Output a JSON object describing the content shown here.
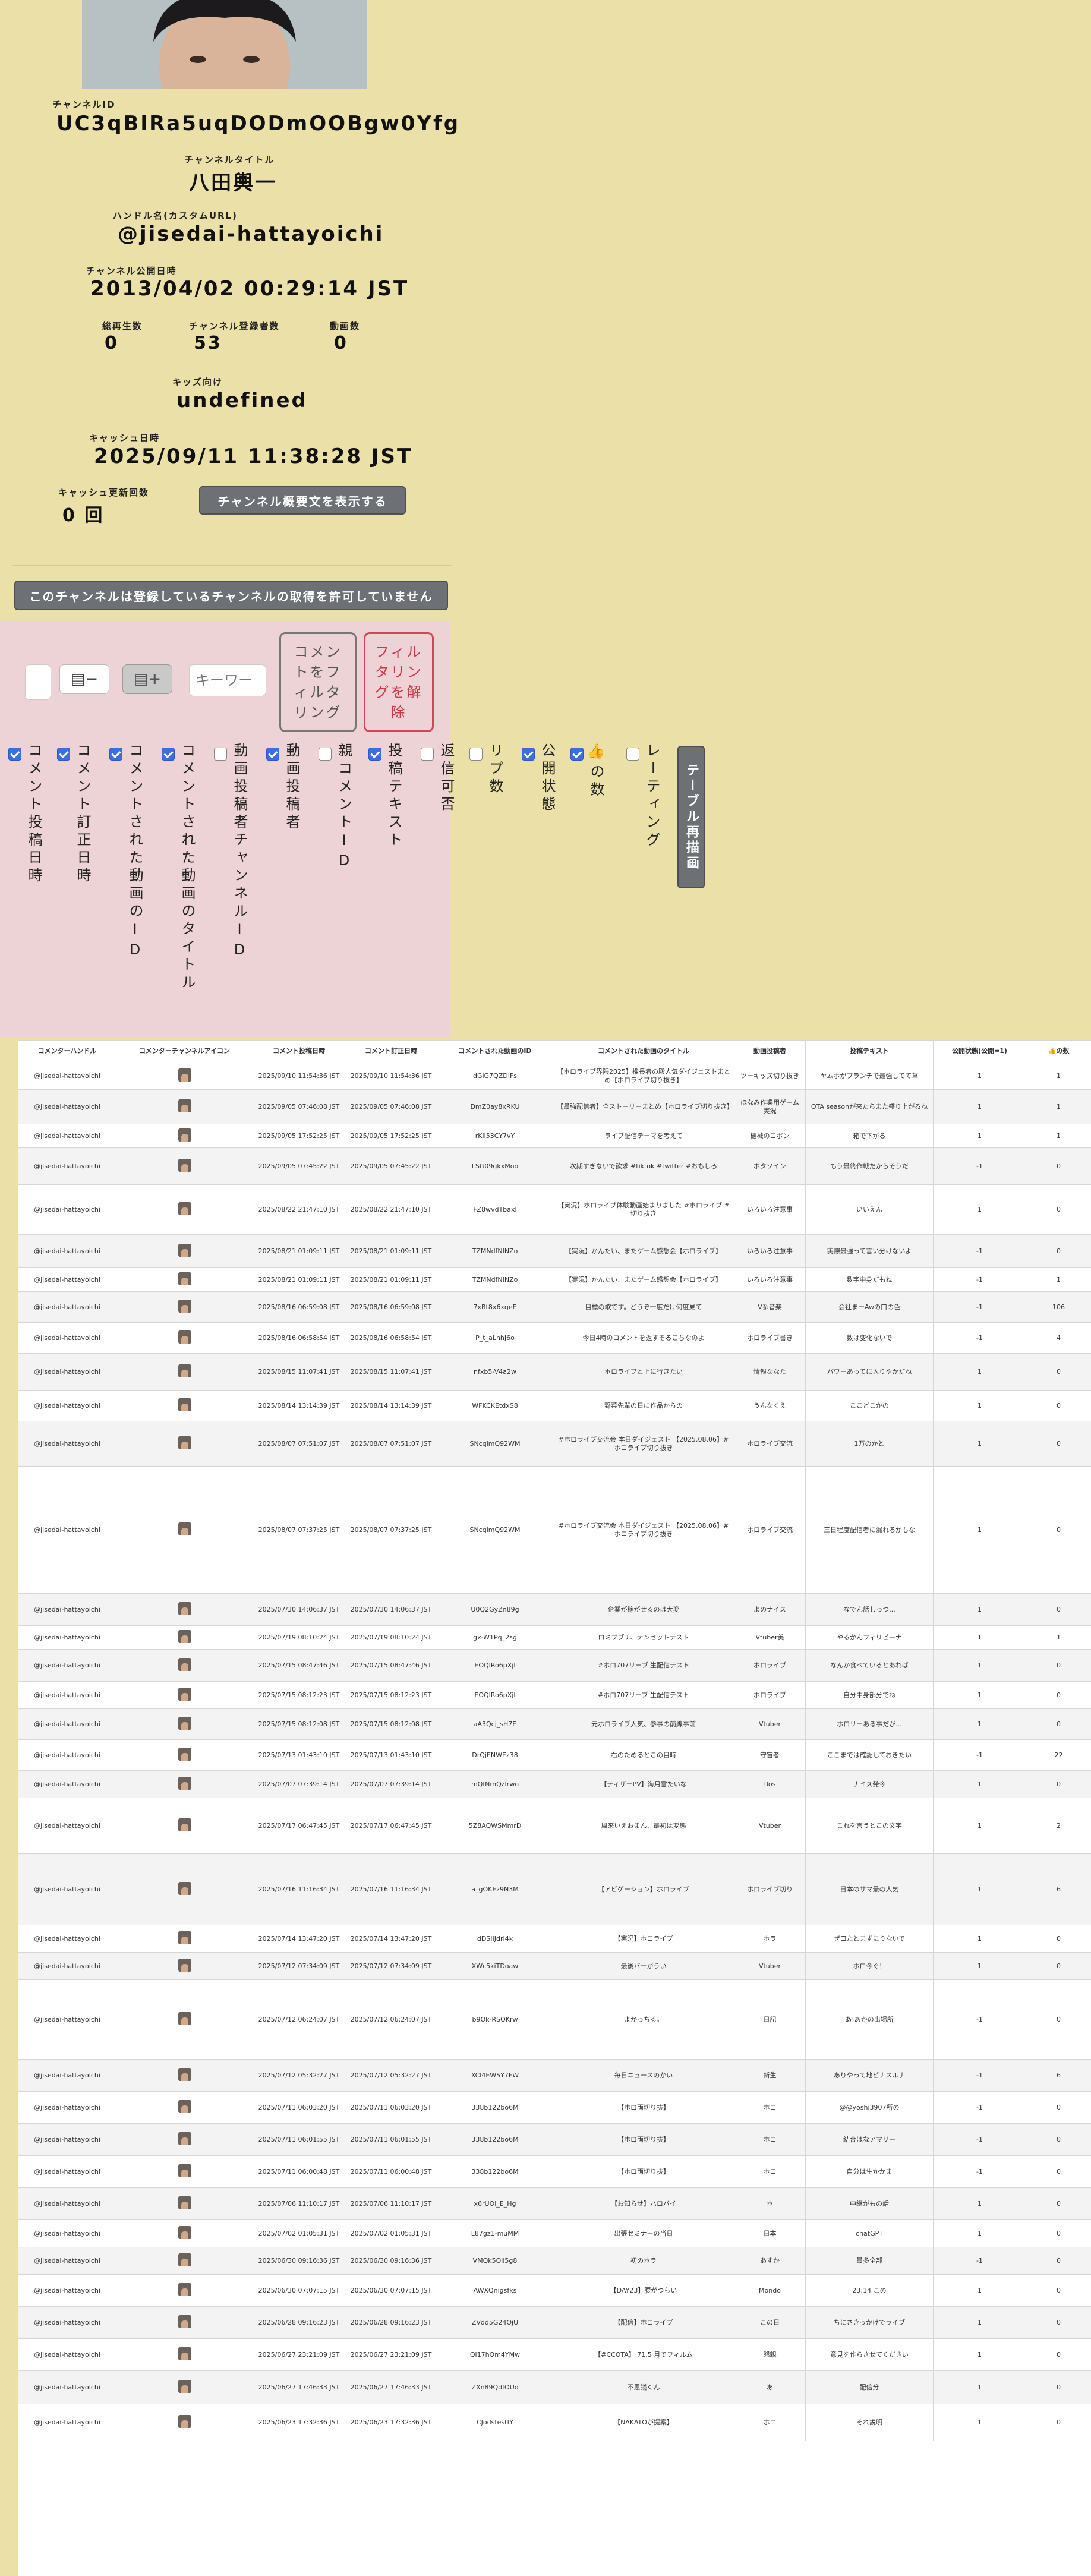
{
  "channel": {
    "id_label": "チャンネルID",
    "id": "UC3qBlRa5uqDODmOOBgw0Yfg",
    "title_label": "チャンネルタイトル",
    "title": "八田輿一",
    "handle_label": "ハンドル名(カスタムURL)",
    "handle": "@jisedai-hattayoichi",
    "published_label": "チャンネル公開日時",
    "published": "2013/04/02 00:29:14 JST",
    "views_label": "総再生数",
    "views": "0",
    "subs_label": "チャンネル登録者数",
    "subs": "53",
    "videos_label": "動画数",
    "videos": "0",
    "kids_label": "キッズ向け",
    "kids": "undefined",
    "cache_label": "キャッシュ日時",
    "cache": "2025/09/11 11:38:28 JST",
    "cache_count_label": "キャッシュ更新回数",
    "cache_count": "0 回",
    "show_desc_button": "チャンネル概要文を表示する",
    "no_subs_button": "このチャンネルは登録しているチャンネルの取得を許可していません"
  },
  "filter": {
    "minus_icon": "▤−",
    "plus_icon": "▤+",
    "keyword_placeholder": "キーワー",
    "filter_button": "コメントをフィルタリング",
    "clear_button": "フィルタリングを解除",
    "redraw_button": "テーブル再描画",
    "columns": [
      {
        "label": "コメント投稿日時",
        "checked": true
      },
      {
        "label": "コメント訂正日時",
        "checked": true
      },
      {
        "label": "コメントされた動画のID",
        "checked": true
      },
      {
        "label": "コメントされた動画のタイトル",
        "checked": true
      },
      {
        "label": "動画投稿者チャンネルID",
        "checked": false
      },
      {
        "label": "動画投稿者",
        "checked": true
      },
      {
        "label": "親コメントID",
        "checked": false
      },
      {
        "label": "投稿テキスト",
        "checked": true
      },
      {
        "label": "返信可否",
        "checked": false
      },
      {
        "label": "リプ数",
        "checked": false
      },
      {
        "label": "公開状態",
        "checked": true
      },
      {
        "label": "👍の数",
        "checked": true
      },
      {
        "label": "レーティング",
        "checked": false
      }
    ]
  },
  "table": {
    "headers": [
      "コメンターハンドル",
      "コメンターチャンネルアイコン",
      "コメント投稿日時",
      "コメント訂正日時",
      "コメントされた動画のID",
      "コメントされた動画のタイトル",
      "動画投稿者",
      "投稿テキスト",
      "公開状態(公開=1)",
      "👍の数"
    ],
    "rows": [
      [
        "@jisedai-hattayoichi",
        "2025/09/10 11:54:36 JST",
        "2025/09/10 11:54:36 JST",
        "dGiG7QZDIFs",
        "【ホロライブ界隈2025】推長者の殿人気ダイジェストまとめ【ホロライブ切り抜き】",
        "ツーキッズ切り抜き",
        "ヤムホがプランチで最強してて草",
        "1",
        "1"
      ],
      [
        "@jisedai-hattayoichi",
        "2025/09/05 07:46:08 JST",
        "2025/09/05 07:46:08 JST",
        "DmZ0ay8xRKU",
        "【最強配信者】全ストーリーまとめ【ホロライブ切り抜き】",
        "ほなみ作業用ゲーム実況",
        "OTA seasonが来たらまた盛り上がるね",
        "1",
        "1"
      ],
      [
        "@jisedai-hattayoichi",
        "2025/09/05 17:52:25 JST",
        "2025/09/05 17:52:25 JST",
        "rKiI53CY7vY",
        "ライブ配信テーマを考えて",
        "機械のロボン",
        "箱で下がる",
        "1",
        "1"
      ],
      [
        "@jisedai-hattayoichi",
        "2025/09/05 07:45:22 JST",
        "2025/09/05 07:45:22 JST",
        "LSG09gkxMoo",
        "次期すぎないで欲求 #tiktok #twitter #おもしろ",
        "ホタソイン",
        "もう最終作戦だからそうだ",
        "-1",
        "0"
      ],
      [
        "@jisedai-hattayoichi",
        "2025/08/22 21:47:10 JST",
        "2025/08/22 21:47:10 JST",
        "FZ8wvdTbaxI",
        "【実況】ホロライブ体験動画始まりました #ホロライブ #切り抜き",
        "いろいろ注意事",
        "いいえん",
        "1",
        "0"
      ],
      [
        "@jisedai-hattayoichi",
        "2025/08/21 01:09:11 JST",
        "2025/08/21 01:09:11 JST",
        "TZMNdfNINZo",
        "【実況】かんたい、またゲーム感想会【ホロライブ】",
        "いろいろ注意事",
        "実際最強って言い分けないよ",
        "-1",
        "0"
      ],
      [
        "@jisedai-hattayoichi",
        "2025/08/21 01:09:11 JST",
        "2025/08/21 01:09:11 JST",
        "TZMNdfNINZo",
        "【実況】かんたい、またゲーム感想会【ホロライブ】",
        "いろいろ注意事",
        "数字中身だもね",
        "-1",
        "1"
      ],
      [
        "@jisedai-hattayoichi",
        "2025/08/16 06:59:08 JST",
        "2025/08/16 06:59:08 JST",
        "7xBt8x6xgeE",
        "目標の歌です。どうぞ一度だけ何度見て",
        "V系音楽",
        "会社まーAwの口の色",
        "-1",
        "106"
      ],
      [
        "@jisedai-hattayoichi",
        "2025/08/16 06:58:54 JST",
        "2025/08/16 06:58:54 JST",
        "P_t_aLnhJ6o",
        "今日4時のコメントを返すそるこちなのよ",
        "ホロライブ書き",
        "数は変化ないで",
        "-1",
        "4"
      ],
      [
        "@jisedai-hattayoichi",
        "2025/08/15 11:07:41 JST",
        "2025/08/15 11:07:41 JST",
        "nfxb5-V4a2w",
        "ホロライブと上に行きたい",
        "情報ななた",
        "パワーあってに入りやかだね",
        "1",
        "0"
      ],
      [
        "@jisedai-hattayoichi",
        "2025/08/14 13:14:39 JST",
        "2025/08/14 13:14:39 JST",
        "WFKCKEtdxS8",
        "野菜先輩の日に作品からの",
        "うんなくえ",
        "ここどこかの",
        "1",
        "0"
      ],
      [
        "@jisedai-hattayoichi",
        "2025/08/07 07:51:07 JST",
        "2025/08/07 07:51:07 JST",
        "SNcqimQ92WM",
        "#ホロライブ交流会 本日ダイジェスト 【2025.08.06】#ホロライブ切り抜き",
        "ホロライブ交流",
        "1万のかと",
        "1",
        "0"
      ],
      [
        "@jisedai-hattayoichi",
        "2025/08/07 07:37:25 JST",
        "2025/08/07 07:37:25 JST",
        "SNcqimQ92WM",
        "#ホロライブ交流会 本日ダイジェスト 【2025.08.06】#ホロライブ切り抜き",
        "ホロライブ交流",
        "三日程度配信者に漏れるかもな",
        "1",
        "0"
      ],
      [
        "@jisedai-hattayoichi",
        "2025/07/30 14:06:37 JST",
        "2025/07/30 14:06:37 JST",
        "U0Q2GyZn89g",
        "企業が稼がせるのは大変",
        "よのナイス",
        "なでん話しっつ...",
        "1",
        "0"
      ],
      [
        "@jisedai-hattayoichi",
        "2025/07/19 08:10:24 JST",
        "2025/07/19 08:10:24 JST",
        "gx-W1Pq_2sg",
        "ロミブブチ、テンセットテスト",
        "Vtuber美",
        "やるかんフィリピーナ",
        "1",
        "1"
      ],
      [
        "@jisedai-hattayoichi",
        "2025/07/15 08:47:46 JST",
        "2025/07/15 08:47:46 JST",
        "EOQIRo6pXjI",
        "#ホロ707リーブ 生配信テスト",
        "ホロライブ",
        "なんか食べているとあれば",
        "1",
        "0"
      ],
      [
        "@jisedai-hattayoichi",
        "2025/07/15 08:12:23 JST",
        "2025/07/15 08:12:23 JST",
        "EOQIRo6pXjI",
        "#ホロ707リーブ 生配信テスト",
        "ホロライブ",
        "自分中身部分でね",
        "1",
        "0"
      ],
      [
        "@jisedai-hattayoichi",
        "2025/07/15 08:12:08 JST",
        "2025/07/15 08:12:08 JST",
        "aA3Qcj_sH7E",
        "元ホロライブ人気、参事の前線事前",
        "Vtuber",
        "ホロリーある事だが...",
        "1",
        "0"
      ],
      [
        "@jisedai-hattayoichi",
        "2025/07/13 01:43:10 JST",
        "2025/07/13 01:43:10 JST",
        "DrQjENWEz38",
        "右のためるとこの目時",
        "守宙者",
        "ここまでは確認しておきたい",
        "-1",
        "22"
      ],
      [
        "@jisedai-hattayoichi",
        "2025/07/07 07:39:14 JST",
        "2025/07/07 07:39:14 JST",
        "mQfNmQzIrwo",
        "【ティザーPV】海月雪たいな",
        "Ros",
        "ナイス発今",
        "1",
        "0"
      ],
      [
        "@jisedai-hattayoichi",
        "2025/07/17 06:47:45 JST",
        "2025/07/17 06:47:45 JST",
        "5Z8AQWSMmrD",
        "風来いえおまん、最初は変態",
        "Vtuber",
        "これを言うとこの文字",
        "1",
        "2"
      ],
      [
        "@jisedai-hattayoichi",
        "2025/07/16 11:16:34 JST",
        "2025/07/16 11:16:34 JST",
        "a_gOKEz9N3M",
        "【アビゲーション】ホロライブ",
        "ホロライブ切り",
        "日本のサマ最の人気",
        "1",
        "6"
      ],
      [
        "@jisedai-hattayoichi",
        "2025/07/14 13:47:20 JST",
        "2025/07/14 13:47:20 JST",
        "dDSIIJdrI4k",
        "【実況】ホロライブ",
        "ホラ",
        "ぜ口たとまずにりないで",
        "1",
        "0"
      ],
      [
        "@jisedai-hattayoichi",
        "2025/07/12 07:34:09 JST",
        "2025/07/12 07:34:09 JST",
        "XWc5kiTDoaw",
        "最後バーがうい",
        "Vtuber",
        "ホロ今ぐ！",
        "1",
        "0"
      ],
      [
        "@jisedai-hattayoichi",
        "2025/07/12 06:24:07 JST",
        "2025/07/12 06:24:07 JST",
        "b9Ok-RSOKrw",
        "よかっちる。",
        "日記",
        "あ!あかの出場所",
        "-1",
        "0"
      ],
      [
        "@jisedai-hattayoichi",
        "2025/07/12 05:32:27 JST",
        "2025/07/12 05:32:27 JST",
        "XCl4EWSY7FW",
        "毎日ニュースのかい",
        "新生",
        "ありやって地ピナスルナ",
        "-1",
        "6"
      ],
      [
        "@jisedai-hattayoichi",
        "2025/07/11 06:03:20 JST",
        "2025/07/11 06:03:20 JST",
        "338b122bo6M",
        "【ホロ両切り抜】",
        "ホロ",
        "@@yoshi3907所の",
        "-1",
        "0"
      ],
      [
        "@jisedai-hattayoichi",
        "2025/07/11 06:01:55 JST",
        "2025/07/11 06:01:55 JST",
        "338b122bo6M",
        "【ホロ両切り抜】",
        "ホロ",
        "結合はなアマリー",
        "-1",
        "0"
      ],
      [
        "@jisedai-hattayoichi",
        "2025/07/11 06:00:48 JST",
        "2025/07/11 06:00:48 JST",
        "338b122bo6M",
        "【ホロ両切り抜】",
        "ホロ",
        "自分は生かかま",
        "-1",
        "0"
      ],
      [
        "@jisedai-hattayoichi",
        "2025/07/06 11:10:17 JST",
        "2025/07/06 11:10:17 JST",
        "x6rUOi_E_Hg",
        "【お知らせ】ハロバイ",
        "ホ",
        "中継がもの話",
        "1",
        "0"
      ],
      [
        "@jisedai-hattayoichi",
        "2025/07/02 01:05:31 JST",
        "2025/07/02 01:05:31 JST",
        "L87gz1-muMM",
        "出張セミナーの当日",
        "日本",
        "chatGPT",
        "1",
        "0"
      ],
      [
        "@jisedai-hattayoichi",
        "2025/06/30 09:16:36 JST",
        "2025/06/30 09:16:36 JST",
        "VMQk5Oil5g8",
        "初のホラ",
        "あすか",
        "最多全部",
        "-1",
        "0"
      ],
      [
        "@jisedai-hattayoichi",
        "2025/06/30 07:07:15 JST",
        "2025/06/30 07:07:15 JST",
        "AWXQnigsfks",
        "【DAY23】腰がつらい",
        "Mondo",
        "23:14 この",
        "1",
        "0"
      ],
      [
        "@jisedai-hattayoichi",
        "2025/06/28 09:16:23 JST",
        "2025/06/28 09:16:23 JST",
        "ZVdd5G24OjU",
        "【配信】ホロライブ",
        "この日",
        "ちにさきっかけでライブ",
        "1",
        "0"
      ],
      [
        "@jisedai-hattayoichi",
        "2025/06/27 23:21:09 JST",
        "2025/06/27 23:21:09 JST",
        "Ql17hOm4YMw",
        "【#CCOTA】 71.5 月でフィルム",
        "懇親",
        "意見を作らさせてください",
        "1",
        "0"
      ],
      [
        "@jisedai-hattayoichi",
        "2025/06/27 17:46:33 JST",
        "2025/06/27 17:46:33 JST",
        "ZXn89QdfOUo",
        "不思議くん",
        "あ",
        "配信分",
        "1",
        "0"
      ],
      [
        "@jisedai-hattayoichi",
        "2025/06/23 17:32:36 JST",
        "2025/06/23 17:32:36 JST",
        "CJodstestfY",
        "【NAKATOが提案】",
        "ホロ",
        "それ説明",
        "1",
        "0"
      ]
    ]
  }
}
